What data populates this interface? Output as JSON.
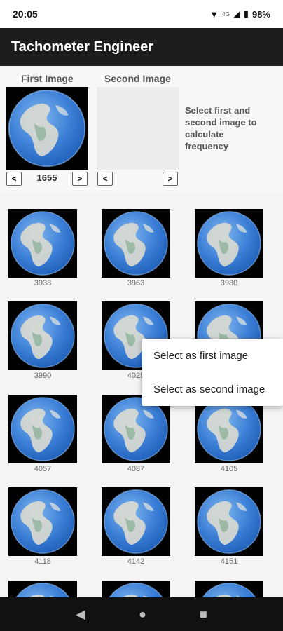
{
  "status": {
    "time": "20:05",
    "network": "4G",
    "battery": "98%"
  },
  "app": {
    "title": "Tachometer Engineer"
  },
  "selection": {
    "first_label": "First Image",
    "second_label": "Second Image",
    "first_frame": "1655",
    "prev_label": "<",
    "next_label": ">",
    "instruction": "Select first and second image to calculate frequency"
  },
  "grid": {
    "tiles": [
      {
        "label": "3938"
      },
      {
        "label": "3963"
      },
      {
        "label": "3980"
      },
      {
        "label": "3990"
      },
      {
        "label": "4025"
      },
      {
        "label": ""
      },
      {
        "label": "4057"
      },
      {
        "label": "4087"
      },
      {
        "label": "4105"
      },
      {
        "label": "4118"
      },
      {
        "label": "4142"
      },
      {
        "label": "4151"
      },
      {
        "label": ""
      },
      {
        "label": ""
      },
      {
        "label": ""
      }
    ]
  },
  "context_menu": {
    "items": [
      {
        "label": "Select as first image"
      },
      {
        "label": "Select as second image"
      }
    ]
  },
  "colors": {
    "app_bar": "#1d1d1d",
    "globe_ocean": "#3b7ed6",
    "globe_land": "#dcdcd0"
  }
}
